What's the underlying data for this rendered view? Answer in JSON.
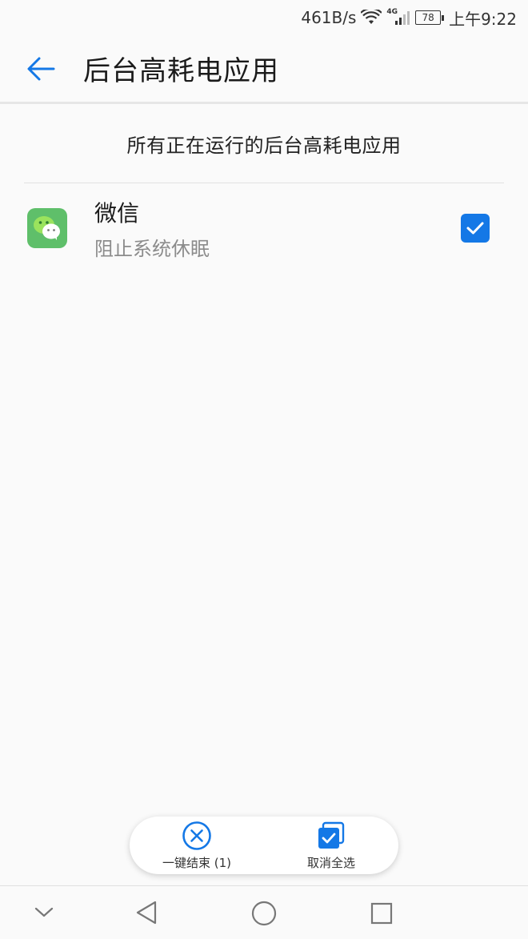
{
  "status_bar": {
    "net_speed": "461B/s",
    "signal_type": "4G",
    "battery": "78",
    "time": "上午9:22"
  },
  "app_bar": {
    "title": "后台高耗电应用"
  },
  "section": {
    "header": "所有正在运行的后台高耗电应用"
  },
  "apps": [
    {
      "name": "微信",
      "reason": "阻止系统休眠",
      "checked": true,
      "icon": "wechat-icon"
    }
  ],
  "actions": {
    "end_all_label": "一键结束 (1)",
    "deselect_all_label": "取消全选"
  },
  "colors": {
    "accent": "#1478e6",
    "wechat_green": "#5fbf6a"
  }
}
